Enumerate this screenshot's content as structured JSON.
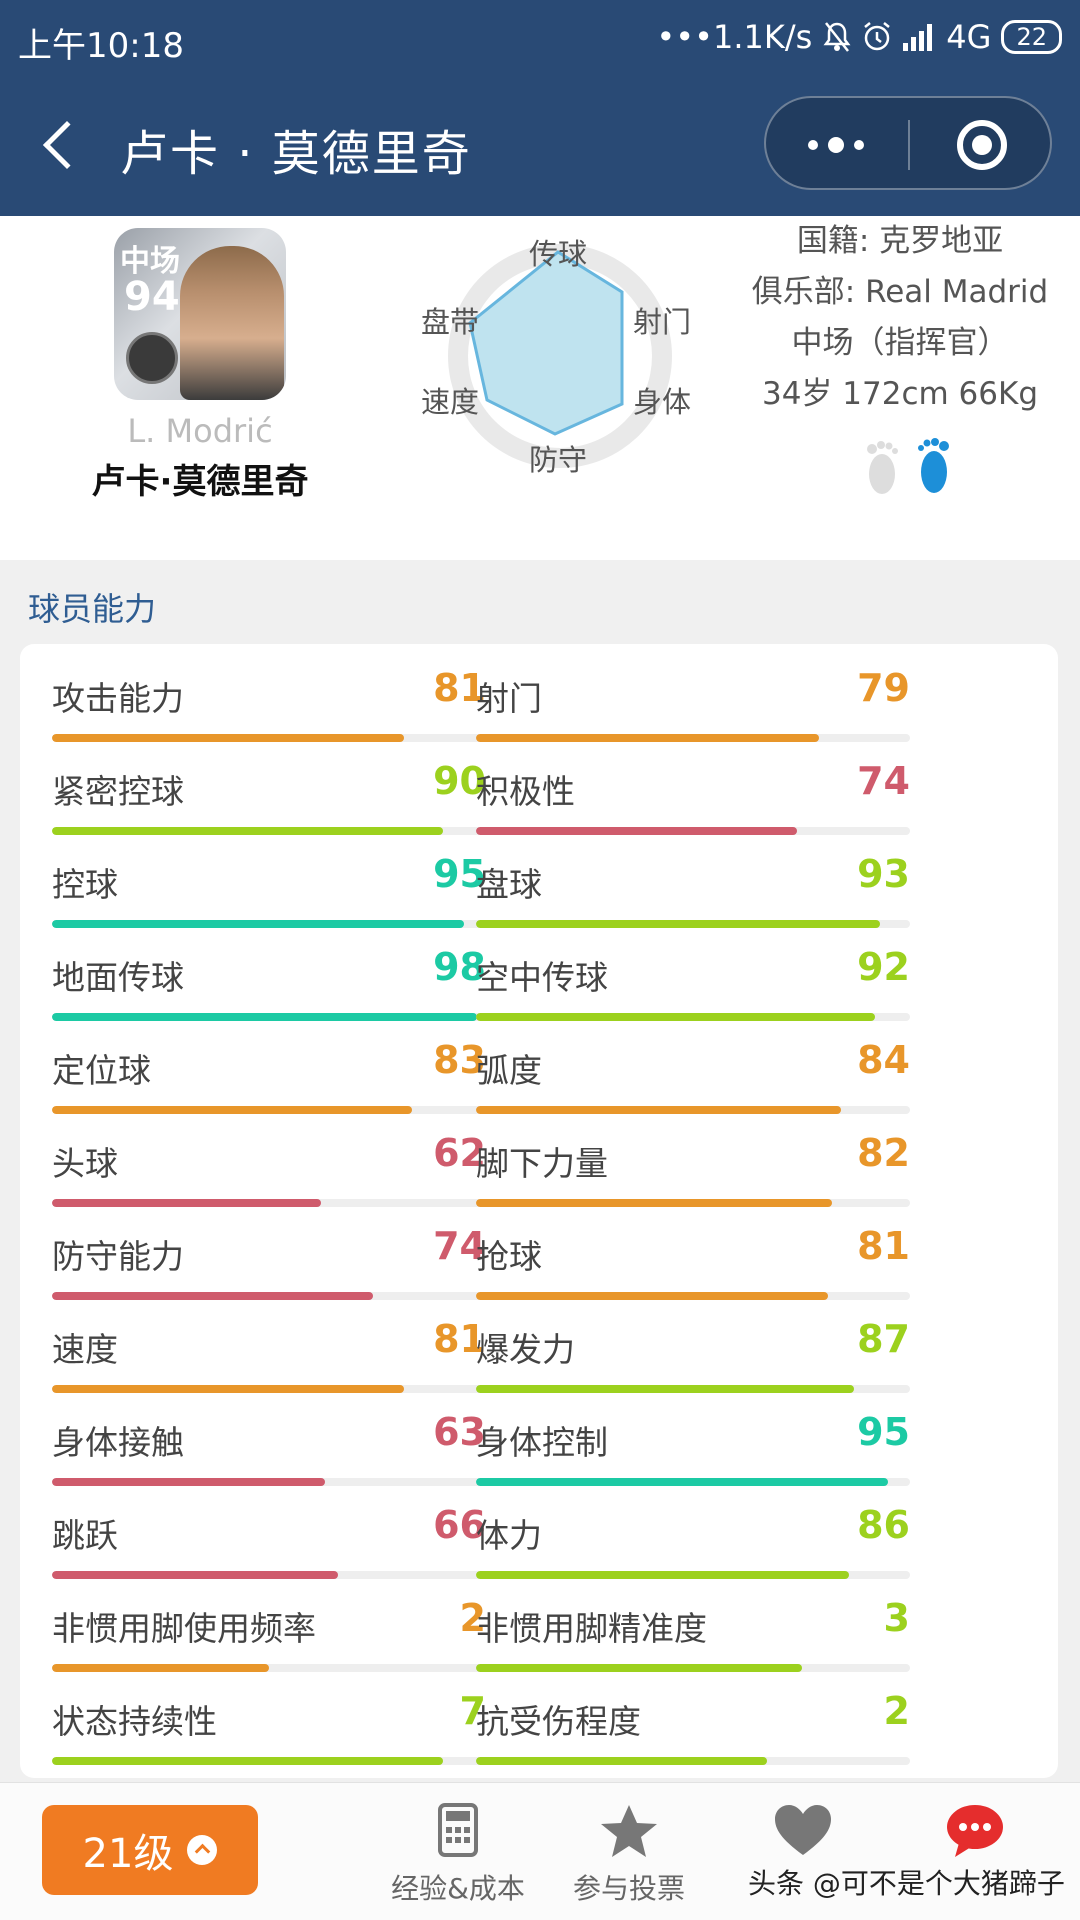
{
  "status_bar": {
    "time": "上午10:18",
    "network_speed": "•••1.1K/s",
    "signal": "4G",
    "battery": "22"
  },
  "nav": {
    "title": "卢卡 · 莫德里奇"
  },
  "player": {
    "card_position": "中场",
    "card_rating": "94",
    "name_en": "L. Modrić",
    "name_cn": "卢卡·莫德里奇",
    "nationality": "国籍: 克罗地亚",
    "club": "俱乐部: Real Madrid",
    "role": "中场（指挥官）",
    "physical": "34岁 172cm 66Kg"
  },
  "radar": {
    "labels": {
      "pass": "传球",
      "shoot": "射门",
      "body": "身体",
      "defense": "防守",
      "speed": "速度",
      "dribble": "盘带"
    }
  },
  "section_title": "球员能力",
  "colors": {
    "orange": "#e8962a",
    "lime": "#9cd11e",
    "teal": "#1ccaa4",
    "red": "#cf5b6c",
    "header": "#294a75",
    "accent_button": "#f07b22"
  },
  "stats_left": [
    {
      "label": "攻击能力",
      "value": "81",
      "fill": 0.81,
      "color": "orange"
    },
    {
      "label": "紧密控球",
      "value": "90",
      "fill": 0.9,
      "color": "lime"
    },
    {
      "label": "控球",
      "value": "95",
      "fill": 0.95,
      "color": "teal"
    },
    {
      "label": "地面传球",
      "value": "98",
      "fill": 0.98,
      "color": "teal"
    },
    {
      "label": "定位球",
      "value": "83",
      "fill": 0.83,
      "color": "orange"
    },
    {
      "label": "头球",
      "value": "62",
      "fill": 0.62,
      "color": "red"
    },
    {
      "label": "防守能力",
      "value": "74",
      "fill": 0.74,
      "color": "red"
    },
    {
      "label": "速度",
      "value": "81",
      "fill": 0.81,
      "color": "orange"
    },
    {
      "label": "身体接触",
      "value": "63",
      "fill": 0.63,
      "color": "red"
    },
    {
      "label": "跳跃",
      "value": "66",
      "fill": 0.66,
      "color": "red"
    },
    {
      "label": "非惯用脚使用频率",
      "value": "2",
      "fill": 0.5,
      "color": "orange"
    },
    {
      "label": "状态持续性",
      "value": "7",
      "fill": 0.9,
      "color": "lime"
    }
  ],
  "stats_right": [
    {
      "label": "射门",
      "value": "79",
      "fill": 0.79,
      "color": "orange"
    },
    {
      "label": "积极性",
      "value": "74",
      "fill": 0.74,
      "color": "red"
    },
    {
      "label": "盘球",
      "value": "93",
      "fill": 0.93,
      "color": "lime"
    },
    {
      "label": "空中传球",
      "value": "92",
      "fill": 0.92,
      "color": "lime"
    },
    {
      "label": "弧度",
      "value": "84",
      "fill": 0.84,
      "color": "orange"
    },
    {
      "label": "脚下力量",
      "value": "82",
      "fill": 0.82,
      "color": "orange"
    },
    {
      "label": "抢球",
      "value": "81",
      "fill": 0.81,
      "color": "orange"
    },
    {
      "label": "爆发力",
      "value": "87",
      "fill": 0.87,
      "color": "lime"
    },
    {
      "label": "身体控制",
      "value": "95",
      "fill": 0.95,
      "color": "teal"
    },
    {
      "label": "体力",
      "value": "86",
      "fill": 0.86,
      "color": "lime"
    },
    {
      "label": "非惯用脚精准度",
      "value": "3",
      "fill": 0.75,
      "color": "lime"
    },
    {
      "label": "抗受伤程度",
      "value": "2",
      "fill": 0.67,
      "color": "lime"
    }
  ],
  "bottom_bar": {
    "level": "21级",
    "tabs": [
      {
        "label": "经验&成本",
        "icon": "calculator-icon"
      },
      {
        "label": "参与投票",
        "icon": "star-icon"
      },
      {
        "label": "",
        "icon": "heart-icon"
      },
      {
        "label": "",
        "icon": "chat-bubble-icon"
      }
    ],
    "watermark": "头条 @可不是个大猪蹄子"
  }
}
